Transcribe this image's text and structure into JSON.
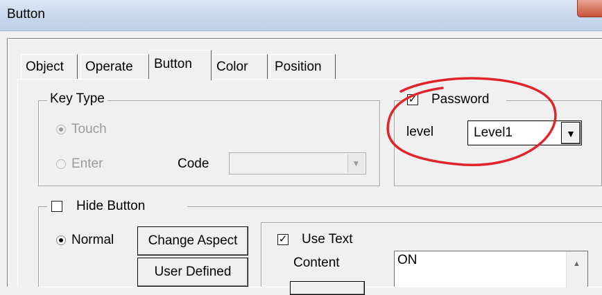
{
  "window": {
    "title": "Button"
  },
  "tabs": [
    {
      "label": "Object"
    },
    {
      "label": "Operate"
    },
    {
      "label": "Button"
    },
    {
      "label": "Color"
    },
    {
      "label": "Position"
    }
  ],
  "key_type": {
    "legend": "Key Type",
    "touch_label": "Touch",
    "enter_label": "Enter",
    "code_label": "Code",
    "code_value": ""
  },
  "password": {
    "label": "Password",
    "checked": true,
    "level_label": "level",
    "level_value": "Level1"
  },
  "hide_button": {
    "label": "Hide Button",
    "checked": false,
    "normal_label": "Normal",
    "change_aspect_label": "Change Aspect",
    "user_defined_label": "User Defined"
  },
  "use_text": {
    "label": "Use Text",
    "checked": true,
    "content_label": "Content",
    "content_value": "ON"
  },
  "icons": {
    "dropdown": "chevron-down-icon",
    "scroll_up": "scroll-up-arrow-icon",
    "annotation": "red-ellipse-annotation"
  },
  "colors": {
    "annotation": "#e0242a",
    "titlebar": "#c6d6ec",
    "close": "#c7533a"
  }
}
